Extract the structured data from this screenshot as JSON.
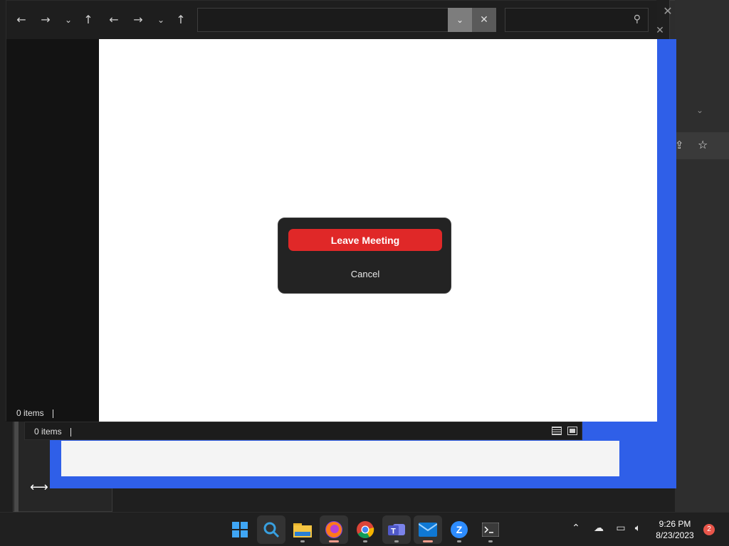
{
  "colors": {
    "leave_button": "#e02828",
    "blue_window": "#2f5fe8",
    "dialog_bg": "#232323",
    "taskbar_bg": "#202020"
  },
  "explorer": {
    "status_items": "0 items",
    "nav": [
      "back-arrow-icon",
      "forward-arrow-icon",
      "history-dropdown-icon",
      "up-arrow-icon"
    ],
    "address_value": "",
    "search_value": ""
  },
  "explorer_back": {
    "status_items": "0 items"
  },
  "dialog": {
    "leave_label": "Leave Meeting",
    "cancel_label": "Cancel"
  },
  "taskbar": {
    "apps": [
      "windows-start-icon",
      "search-icon",
      "file-explorer-icon",
      "firefox-icon",
      "chrome-icon",
      "teams-icon",
      "mail-icon",
      "zoom-icon",
      "terminal-icon"
    ],
    "time": "9:26 PM",
    "date": "8/23/2023",
    "notification_count": "2"
  }
}
